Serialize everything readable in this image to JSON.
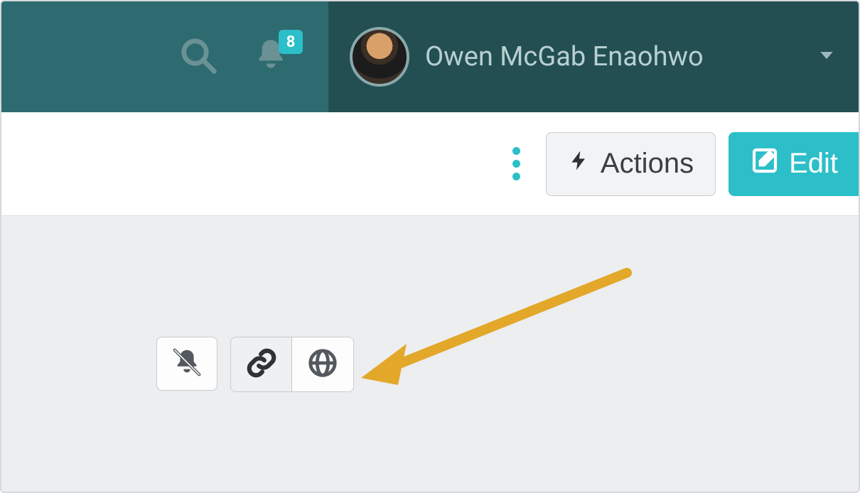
{
  "header": {
    "notification_count": "8",
    "user_name": "Owen McGab Enaohwo",
    "icons": {
      "search": "search-icon",
      "bell": "bell-icon",
      "chevron": "chevron-down-icon"
    }
  },
  "toolbar": {
    "more_label": "more-icon",
    "actions_label": "Actions",
    "edit_label": "Edit"
  },
  "body": {
    "icons": {
      "mute": "bell-slash-icon",
      "link": "link-icon",
      "globe": "globe-icon"
    }
  }
}
